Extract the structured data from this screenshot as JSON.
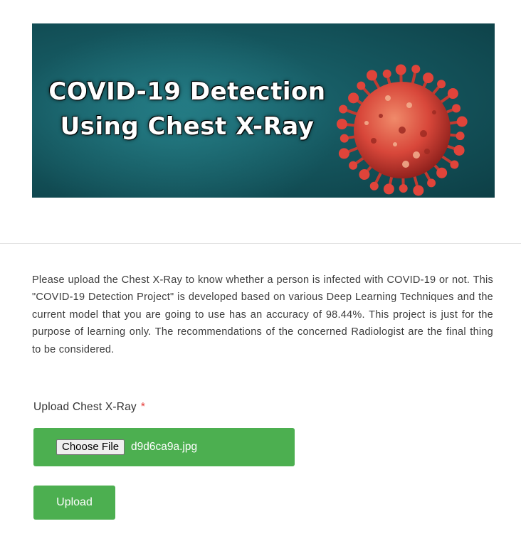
{
  "banner": {
    "title_line1": "COVID-19 Detection",
    "title_line2": "Using Chest X-Ray",
    "illustration_icon": "coronavirus-icon",
    "background_color": "#15575f",
    "virus_color": "#d8473a"
  },
  "intro": {
    "text": "Please upload the Chest X-Ray to know whether a person is infected with COVID-19 or not. This \"COVID-19 Detection Project\" is developed based on various Deep Learning Techniques and the current model that you are going to use has an accuracy of 98.44%. This project is just for the purpose of learning only. The recommendations of the concerned Radiologist are the final thing to be considered."
  },
  "form": {
    "label": "Upload Chest X-Ray",
    "required_marker": "*",
    "choose_file_label": "Choose File",
    "selected_file": "d9d6ca9a.jpg",
    "upload_button_label": "Upload"
  },
  "colors": {
    "accent": "#4caf50",
    "required": "#e53935",
    "divider": "#e3e3e3"
  }
}
